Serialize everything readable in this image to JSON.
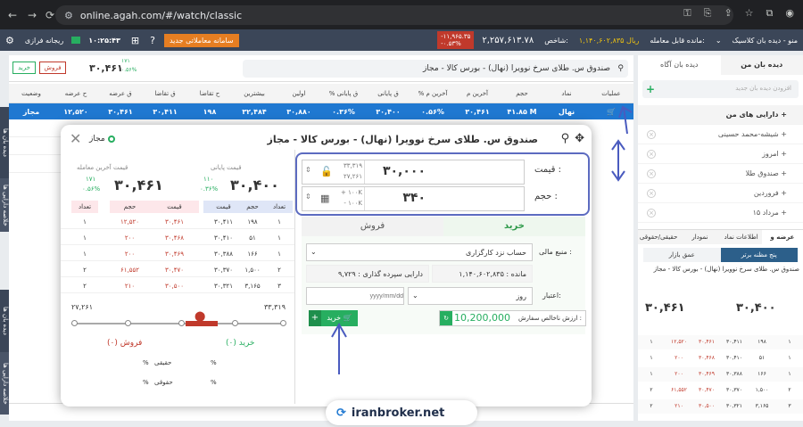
{
  "browser": {
    "url": "online.agah.com/#/watch/classic"
  },
  "topbar": {
    "menu": "منو - دیده بان کلاسیک",
    "balance_label": "مانده قابل معامله:",
    "balance_value": "۱,۱۴۰,۶۰۲,۸۳۵ ریال",
    "index_label": "شاخص:",
    "index_value": "۲,۲۵۷,۶۱۳.۷۸",
    "index_change_1": "-۱۱,۹۶۵.۳۵",
    "index_change_2": "-۰.۵۳%",
    "new_system_button": "سامانه معاملاتی جدید",
    "clock": "۱۰:۲۵:۴۳",
    "risk_label": "ریجانه فرازی"
  },
  "watch_header": {
    "search_text": "صندوق س. طلای سرخ نوویرا (نهال) - بورس کالا - مجاز",
    "price": "۳۰,۴۶۱",
    "change_value": "۱۷۱",
    "change_percent": "۰.۵۶%",
    "buy_button": "خرید",
    "sell_button": "فروش"
  },
  "table": {
    "headers": [
      "عملیات",
      "نماد",
      "حجم",
      "آخرین م",
      "% آخرین م",
      "ق پایانی",
      "% ق پایانی",
      "اولین",
      "بیشترین",
      "ح تقاضا",
      "ق تقاضا",
      "ق عرضه",
      "ح عرضه",
      "وضعیت"
    ],
    "selected_row": [
      "",
      "نهال",
      "۴۱.۸۵ M",
      "۳۰,۴۶۱",
      "۰.۵۶%",
      "۳۰,۴۰۰",
      "۰.۳۶%",
      "۳۰,۸۸۰",
      "۳۲,۴۸۴",
      "۱۹۸",
      "۳۰,۴۱۱",
      "۳۰,۴۶۱",
      "۱۲,۵۲۰",
      "مجاز"
    ]
  },
  "modal": {
    "title": "صندوق س. طلای سرخ نوویرا (نهال) - بورس کالا - مجاز",
    "status": "مجاز",
    "last_trade_label": "قیمت آخرین معامله",
    "last_trade_price": "۳۰,۴۶۱",
    "last_trade_change": "۱۷۱",
    "last_trade_pct": "۰.۵۶%",
    "final_label": "قیمت پایانی",
    "final_price": "۳۰,۴۰۰",
    "final_change": "۱۱۰",
    "final_pct": "۰.۳۶%",
    "depth_headers": [
      "تعداد",
      "حجم",
      "قیمت",
      "قیمت",
      "حجم",
      "تعداد"
    ],
    "depth_rows": [
      [
        "۱",
        "۱۹۸",
        "۳۰,۴۱۱",
        "۳۰,۴۶۱",
        "۱۲,۵۲۰",
        "۱"
      ],
      [
        "۱",
        "۵۱",
        "۳۰,۴۱۰",
        "۳۰,۴۶۸",
        "۲۰۰",
        "۱"
      ],
      [
        "۱",
        "۱۶۶",
        "۳۰,۳۸۸",
        "۳۰,۴۶۹",
        "۲۰۰",
        "۱"
      ],
      [
        "۲",
        "۱,۵۰۰",
        "۳۰,۳۷۰",
        "۳۰,۴۷۰",
        "۶۱,۵۵۲",
        "۲"
      ],
      [
        "۳",
        "۳,۱۶۵",
        "۳۰,۳۲۱",
        "۳۰,۵۰۰",
        "۲۱۰",
        "۲"
      ]
    ],
    "range_min": "۲۷,۲۶۱",
    "range_max": "۳۳,۳۱۹",
    "buy_count": "خرید (۰)",
    "sell_count": "فروش (۰)",
    "real_label": "حقیقی",
    "legal_label": "حقوقی",
    "percent_sign": "%",
    "price_label": "قیمت :",
    "price_value": "۳۰,۰۰۰",
    "price_range_hi": "۳۳,۳۱۹",
    "price_range_lo": "۲۷,۲۶۱",
    "volume_label": "حجم :",
    "volume_value": "۳۴۰",
    "volume_plus": "+ ۱۰۰K",
    "volume_minus": "- ۱۰۰K",
    "tab_buy": "خرید",
    "tab_sell": "فروش",
    "source_label": "منبع مالی :",
    "source_value": "حساب نزد کارگزاری",
    "remain_label": "مانده : ۱,۱۴۰,۶۰۲,۸۳۵",
    "deposit_label": "دارایی سپرده گذاری : ۹,۷۲۹",
    "validity_label": "اعتبار:",
    "validity_value": "روز",
    "date_placeholder": "yyyy/mm/dd",
    "min_order_label": "ارزش ناخالص سفارش :",
    "min_order_value": "10,200,000",
    "buy_button": "خرید"
  },
  "left_panel": {
    "tab_watch": "دیده بان من",
    "tab_watch2": "دیده بان آگاه",
    "add_placeholder": "افزودن دیده بان جدید",
    "group": "دارایی های من",
    "items": [
      "شیشه-محمد حسینی",
      "امروز",
      "صندوق طلا",
      "فروردین",
      "مرداد ۱۵"
    ]
  },
  "right_lower": {
    "tabs": [
      "عرضه و تقاضا",
      "اطلاعات نماد",
      "نمودار",
      "حقیقی/حقوقی"
    ],
    "subtabs": [
      "پنج مظنه برتر",
      "عمق بازار"
    ],
    "title": "صندوق س. طلای سرخ نوویرا (نهال) - بورس کالا - مجاز",
    "last_price": "۳۰,۴۶۱",
    "final_price": "۳۰,۴۰۰"
  },
  "brand": {
    "text": "iranbroker.net"
  },
  "side_tabs": {
    "top": "دیده بان ها",
    "top2": "خلاصه دارایی ها",
    "bottom": "دیده بان ها",
    "bottom2": "خلاصه دارایی ها"
  },
  "colors": {
    "accent": "#1f78d1",
    "buy": "#27ae60",
    "sell": "#c0392b",
    "highlight": "#5c6bc0"
  }
}
